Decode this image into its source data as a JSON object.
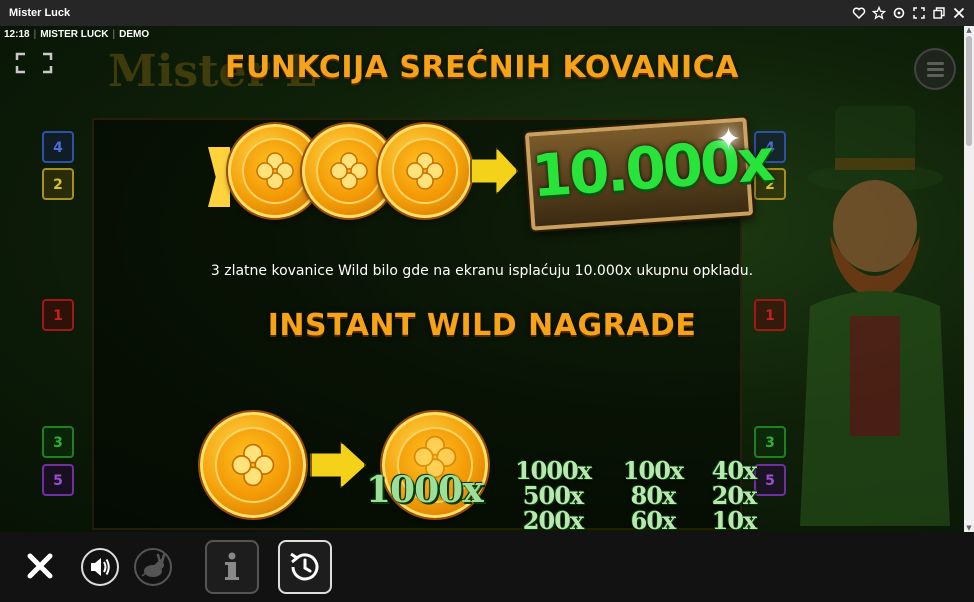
{
  "window": {
    "title": "Mister Luck",
    "controls": [
      "heart-icon",
      "star-icon",
      "reload-icon",
      "maximize-icon",
      "restore-icon",
      "close-icon"
    ]
  },
  "status": {
    "time": "12:18",
    "game": "MISTER LUCK",
    "mode": "DEMO"
  },
  "background": {
    "logo": "Mister L",
    "side_left": [
      "4",
      "2",
      "1",
      "3",
      "5"
    ],
    "side_right": [
      "4",
      "2",
      "1",
      "3",
      "5"
    ]
  },
  "section1": {
    "title": "FUNKCIJA SREĆNIH KOVANICA",
    "multiplier": "10.000x",
    "description": "3 zlatne kovanice Wild bilo gde na ekranu isplaćuju 10.000x ukupnu opkladu."
  },
  "section2": {
    "title": "INSTANT WILD NAGRADE",
    "coin_value": "1000x",
    "multipliers": [
      [
        "1000x",
        "500x",
        "200x"
      ],
      [
        "100x",
        "80x",
        "60x"
      ],
      [
        "40x",
        "20x",
        "10x"
      ]
    ]
  },
  "colors": {
    "heading": "#f7a318",
    "multiplier_green": "#28e43a",
    "coin_gold": "#f4a00a"
  },
  "bottom_bar": {
    "buttons": [
      "close-icon",
      "sound-icon",
      "turbo-icon",
      "info-icon",
      "history-icon"
    ]
  }
}
